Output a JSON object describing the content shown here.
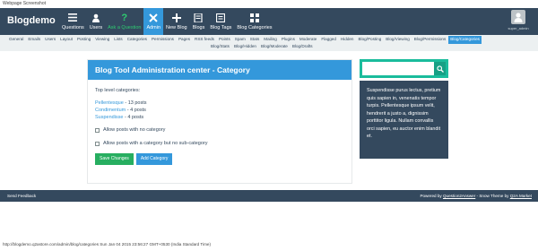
{
  "caption": "Webpage Screenshot",
  "header": {
    "logo": "Blogdemo",
    "nav": [
      {
        "label": "Questions",
        "icon": "list-icon"
      },
      {
        "label": "Users",
        "icon": "users-icon"
      },
      {
        "label": "Ask a Question",
        "icon": "question-icon"
      },
      {
        "label": "Admin",
        "icon": "tools-icon"
      },
      {
        "label": "New Blog",
        "icon": "new-blog-icon"
      },
      {
        "label": "Blogs",
        "icon": "blogs-icon"
      },
      {
        "label": "Blog Tags",
        "icon": "tags-icon"
      },
      {
        "label": "Blog Categories",
        "icon": "categories-icon"
      }
    ],
    "username": "super_admin"
  },
  "subnav": {
    "row1": [
      "General",
      "Emails",
      "Users",
      "Layout",
      "Posting",
      "Viewing",
      "Lists",
      "Categories",
      "Permissions",
      "Pages",
      "RSS feeds",
      "Points",
      "Spam",
      "Stats",
      "Mailing",
      "Plugins",
      "Moderate",
      "Flagged",
      "Hidden",
      "Blog/Posting",
      "Blog/Viewing",
      "Blog/Permissions",
      "Blog/Categories"
    ],
    "row2": [
      "Blog/Stats",
      "Blog/Hidden",
      "Blog/Moderate",
      "Blog/Drafts"
    ],
    "active": "Blog/Categories"
  },
  "main": {
    "title": "Blog Tool Administration center - Category",
    "top_label": "Top level categories:",
    "categories": [
      {
        "name": "Pellentesque",
        "count": " - 13 posts"
      },
      {
        "name": "Condimentum",
        "count": " - 4 posts"
      },
      {
        "name": "Suspendisse",
        "count": " - 4 posts"
      }
    ],
    "check_no_category": "Allow posts with no category",
    "check_no_subcategory": "Allow posts with a category but no sub-category",
    "save_label": "Save Changes",
    "add_label": "Add Category"
  },
  "search": {
    "placeholder": ""
  },
  "side_text": "Suspendisse purus lectus, pretium quis sapien in, venenatis tempor turpis. Pellentesque ipsum velit, hendrerit a justo a, dignissim porttitor ligula. Nullam convallis orci sapien, eu auctor enim blandit et.",
  "footer": {
    "left": "Send Feedback",
    "powered_by": "Powered by ",
    "powered_link": "Question2Answer",
    "sep": " - ",
    "theme": "Snow Theme by ",
    "theme_link": "Q2A Market"
  },
  "status_text": "http://blogdemo.q2astore.com/admin/blog/categories Sun Jan 04 2015 23:56:27 GMT+0530 (India Standard Time)",
  "colors": {
    "header": "#34495e",
    "accent": "#3498db",
    "ask": "#2ecc71",
    "save": "#27ae60",
    "search": "#1abc9c"
  }
}
